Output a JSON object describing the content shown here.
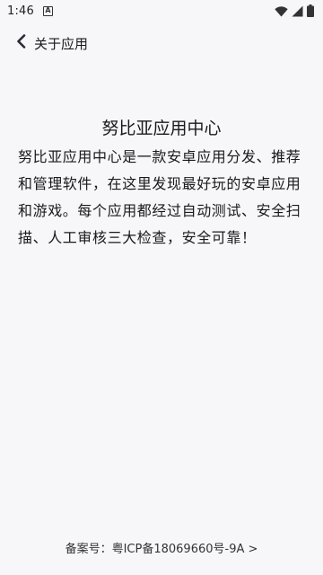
{
  "status_bar": {
    "time": "1:46",
    "notification_icon_text": "A",
    "icons": [
      "wifi-icon",
      "signal-icon",
      "battery-icon"
    ]
  },
  "header": {
    "back_icon": "chevron-left-icon",
    "title": "关于应用"
  },
  "about": {
    "app_name": "努比亚应用中心",
    "description": "努比亚应用中心是一款安卓应用分发、推荐和管理软件，在这里发现最好玩的安卓应用和游戏。每个应用都经过自动测试、安全扫描、人工审核三大检查，安全可靠！"
  },
  "footer": {
    "icp": "备案号：粤ICP备18069660号-9A >"
  },
  "colors": {
    "background": "#f7f7fa",
    "text": "#1a1a1a"
  }
}
